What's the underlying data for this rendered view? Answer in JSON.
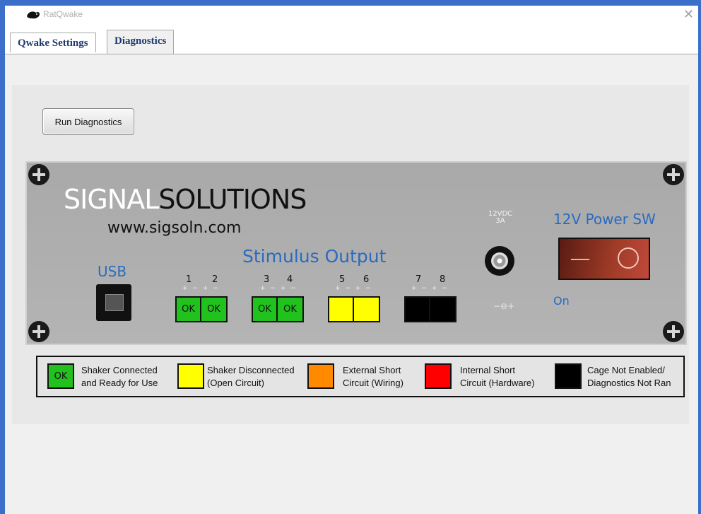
{
  "window": {
    "title": "RatQwake",
    "close_glyph": "✕"
  },
  "tabs": [
    {
      "label": "Qwake Settings",
      "active": false
    },
    {
      "label": "Diagnostics",
      "active": true
    }
  ],
  "toolbar": {
    "run_label": "Run Diagnostics"
  },
  "panel": {
    "brand_signal": "SIGNAL",
    "brand_solutions": "SOLUTIONS",
    "url": "www.sigsoln.com",
    "stimulus_title": "Stimulus Output",
    "usb_label": "USB",
    "pm_marks": "+ − + −",
    "channel_pairs": [
      {
        "nums": [
          "1",
          "2"
        ],
        "states": [
          "OK",
          "OK"
        ],
        "color": "#22c21e"
      },
      {
        "nums": [
          "3",
          "4"
        ],
        "states": [
          "OK",
          "OK"
        ],
        "color": "#22c21e"
      },
      {
        "nums": [
          "5",
          "6"
        ],
        "states": [
          "",
          ""
        ],
        "color": "#ffff00"
      },
      {
        "nums": [
          "7",
          "8"
        ],
        "states": [
          "",
          ""
        ],
        "color": "#000000"
      }
    ],
    "dc_label_line1": "12VDC",
    "dc_label_line2": "3A",
    "polarity_glyph": "−⊖+",
    "power_label": "12V Power SW",
    "on_label": "On"
  },
  "legend": [
    {
      "swatch_text": "OK",
      "color": "#22c21e",
      "line1": "Shaker Connected",
      "line2": "and Ready for Use"
    },
    {
      "swatch_text": "",
      "color": "#ffff00",
      "line1": "Shaker Disconnected",
      "line2": "(Open Circuit)"
    },
    {
      "swatch_text": "",
      "color": "#ff8a00",
      "line1": "External Short",
      "line2": "Circuit (Wiring)"
    },
    {
      "swatch_text": "",
      "color": "#ff0000",
      "line1": "Internal Short",
      "line2": "Circuit (Hardware)"
    },
    {
      "swatch_text": "",
      "color": "#000000",
      "line1": "Cage Not Enabled/",
      "line2": "Diagnostics Not Ran"
    }
  ]
}
